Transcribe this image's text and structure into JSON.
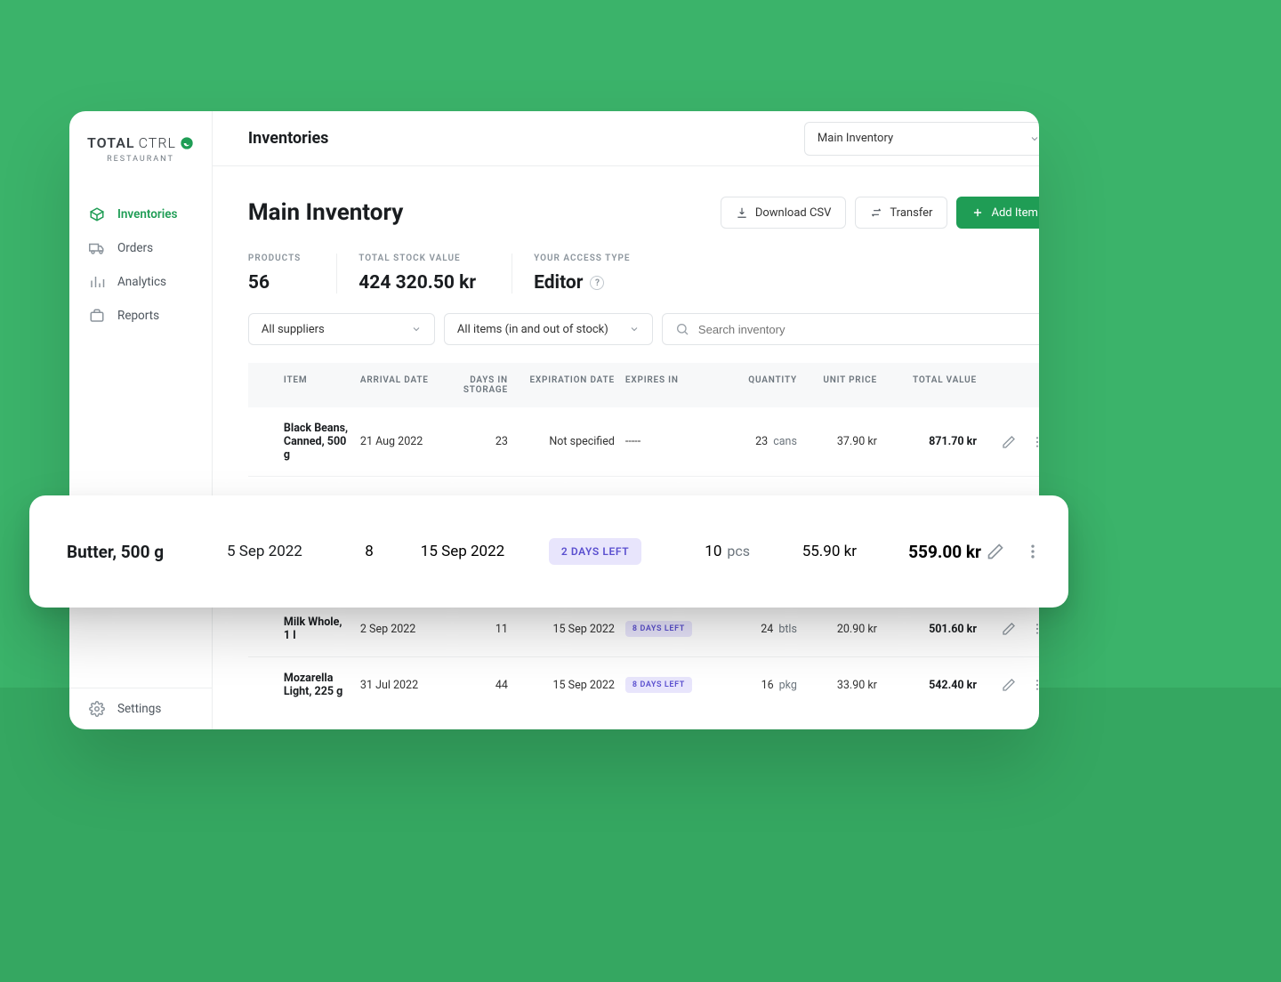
{
  "brand": {
    "name_bold": "TOTAL",
    "name_thin": "CTRL",
    "subtitle": "RESTAURANT"
  },
  "sidebar": {
    "items": [
      {
        "label": "Inventories",
        "icon": "box-icon"
      },
      {
        "label": "Orders",
        "icon": "truck-icon"
      },
      {
        "label": "Analytics",
        "icon": "bars-icon"
      },
      {
        "label": "Reports",
        "icon": "briefcase-icon"
      }
    ],
    "settings_label": "Settings"
  },
  "header": {
    "title": "Inventories",
    "selected_inventory": "Main Inventory"
  },
  "page": {
    "title": "Main Inventory",
    "actions": {
      "download_label": "Download CSV",
      "transfer_label": "Transfer",
      "add_label": "Add Item"
    }
  },
  "stats": {
    "products_label": "PRODUCTS",
    "products_value": "56",
    "stock_label": "TOTAL STOCK VALUE",
    "stock_value": "424 320.50 kr",
    "access_label": "YOUR ACCESS TYPE",
    "access_value": "Editor"
  },
  "filters": {
    "supplier": "All suppliers",
    "stock": "All items (in and out of stock)",
    "search_placeholder": "Search inventory"
  },
  "columns": {
    "item": "ITEM",
    "arrival": "ARRIVAL DATE",
    "days": "DAYS IN STORAGE",
    "expiration": "EXPIRATION DATE",
    "expires_in": "EXPIRES IN",
    "quantity": "QUANTITY",
    "unit_price": "UNIT PRICE",
    "total": "TOTAL VALUE"
  },
  "rows": [
    {
      "item": "Black Beans, Canned, 500 g",
      "arrival": "21 Aug 2022",
      "days": "23",
      "expiration": "Not specified",
      "expires_in": "-----",
      "qty": "23",
      "unit": "cans",
      "price": "37.90 kr",
      "total": "871.70 kr"
    },
    {
      "item": "Milk Whole, 1 l",
      "arrival": "2 Sep 2022",
      "days": "11",
      "expiration": "15 Sep 2022",
      "expires_in": "8  DAYS LEFT",
      "qty": "24",
      "unit": "btls",
      "price": "20.90 kr",
      "total": "501.60 kr"
    },
    {
      "item": "Mozarella Light, 225 g",
      "arrival": "31 Jul 2022",
      "days": "44",
      "expiration": "15 Sep 2022",
      "expires_in": "8  DAYS LEFT",
      "qty": "16",
      "unit": "pkg",
      "price": "33.90 kr",
      "total": "542.40 kr"
    }
  ],
  "featured": {
    "item": "Butter, 500 g",
    "arrival": "5 Sep 2022",
    "days": "8",
    "expiration": "15 Sep 2022",
    "expires_in": "2 DAYS LEFT",
    "qty": "10",
    "unit": "pcs",
    "price": "55.90 kr",
    "total": "559.00 kr"
  },
  "colors": {
    "accent": "#1f9d55",
    "bg": "#3BB36A",
    "badge_bg": "#e8e5fc",
    "badge_fg": "#5a4fcf"
  }
}
